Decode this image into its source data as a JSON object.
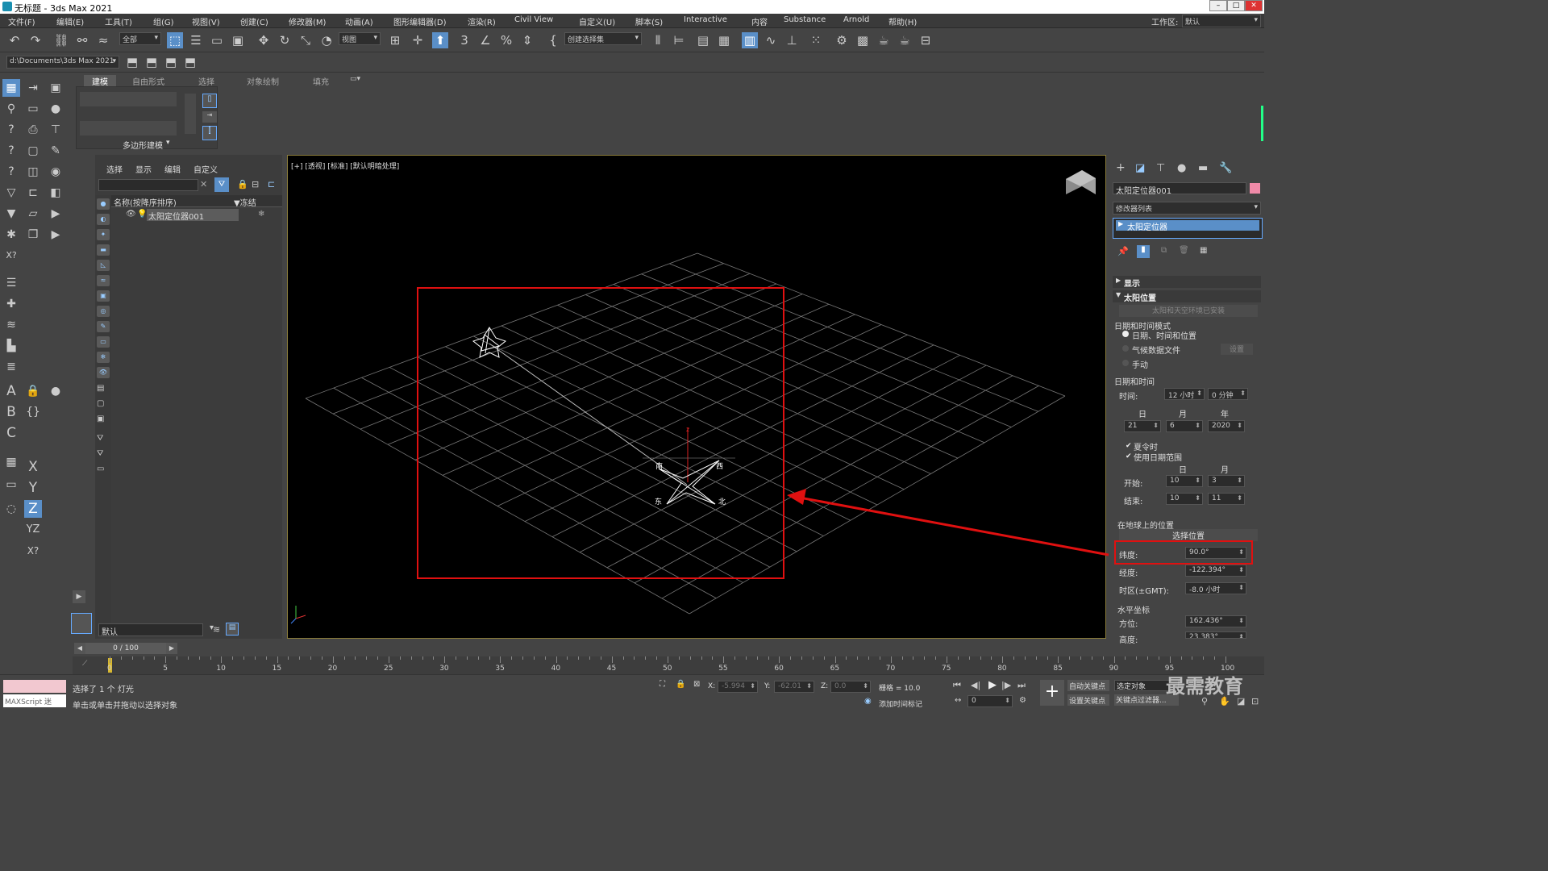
{
  "titlebar": {
    "title": "无标题 - 3ds Max 2021"
  },
  "menubar": {
    "items": [
      "文件(F)",
      "编辑(E)",
      "工具(T)",
      "组(G)",
      "视图(V)",
      "创建(C)",
      "修改器(M)",
      "动画(A)",
      "图形编辑器(D)",
      "渲染(R)",
      "Civil View",
      "自定义(U)",
      "脚本(S)",
      "Interactive",
      "内容",
      "Substance",
      "Arnold",
      "帮助(H)"
    ],
    "workspace_label": "工作区:",
    "workspace_value": "默认"
  },
  "toolbar": {
    "filter_value": "全部",
    "refcoord_value": "视图",
    "selection_set_value": "创建选择集",
    "path_value": "d:\\Documents\\3ds Max 2021"
  },
  "ribbon": {
    "tabs": [
      "建模",
      "自由形式",
      "选择",
      "对象绘制",
      "填充"
    ],
    "group_label": "多边形建模"
  },
  "scene_explorer": {
    "menu": [
      "选择",
      "显示",
      "编辑",
      "自定义"
    ],
    "col_name": "名称(按降序排序)",
    "col_freeze": "▼冻结",
    "row_name": "太阳定位器001",
    "layer_value": "默认",
    "frame_counter": "0 / 100"
  },
  "viewport": {
    "label": "[+] [透视] [标准] [默认明暗处理]",
    "compass": {
      "south": "南",
      "west": "西",
      "east": "东",
      "north": "北",
      "axis_z": "z"
    }
  },
  "cmdpanel": {
    "object_name": "太阳定位器001",
    "modifier_list": "修改器列表",
    "stack_item": "太阳定位器",
    "rollout_display": "显示",
    "rollout_sunpos": "太阳位置",
    "installed": "太阳和天空环境已安装",
    "datetime_mode_label": "日期和时间模式",
    "mode_opt1": "日期、时间和位置",
    "mode_opt2": "气候数据文件",
    "mode_btn_setup": "设置",
    "mode_opt3": "手动",
    "datetime_label": "日期和时间",
    "time_label": "时间:",
    "hour_value": "12 小时",
    "minute_value": "0 分钟",
    "col_day": "日",
    "col_month": "月",
    "col_year": "年",
    "day_value": "21",
    "month_value": "6",
    "year_value": "2020",
    "dst_label": "夏令时",
    "use_range_label": "使用日期范围",
    "range_col_day": "日",
    "range_col_month": "月",
    "start_label": "开始:",
    "start_day": "10",
    "start_month": "3",
    "end_label": "结束:",
    "end_day": "10",
    "end_month": "11",
    "location_label": "在地球上的位置",
    "choose_location": "选择位置",
    "latitude_label": "纬度:",
    "latitude_value": "90.0°",
    "longitude_label": "经度:",
    "longitude_value": "-122.394°",
    "timezone_label": "时区(±GMT):",
    "timezone_value": "-8.0 小时",
    "horizontal_label": "水平坐标",
    "azimuth_label": "方位:",
    "azimuth_value": "162.436°",
    "altitude_label": "高度:",
    "altitude_value": "23.383°"
  },
  "timeline": {
    "ticks": [
      0,
      5,
      10,
      15,
      20,
      25,
      30,
      35,
      40,
      45,
      50,
      55,
      60,
      65,
      70,
      75,
      80,
      85,
      90,
      95,
      100
    ]
  },
  "status": {
    "maxscript": "MAXScript 迷",
    "selected": "选择了 1 个 灯光",
    "prompt": "单击或单击并拖动以选择对象",
    "x_label": "X:",
    "x_value": "-5.994",
    "y_label": "Y:",
    "y_value": "-62.01",
    "z_label": "Z:",
    "z_value": "0.0",
    "grid": "栅格 = 10.0",
    "add_time_tag": "添加时间标记",
    "auto_key": "自动关键点",
    "selected_obj": "选定对象",
    "set_key": "设置关键点",
    "key_filter": "关键点过滤器...",
    "frame_value": "0",
    "watermark": "最需教育"
  }
}
